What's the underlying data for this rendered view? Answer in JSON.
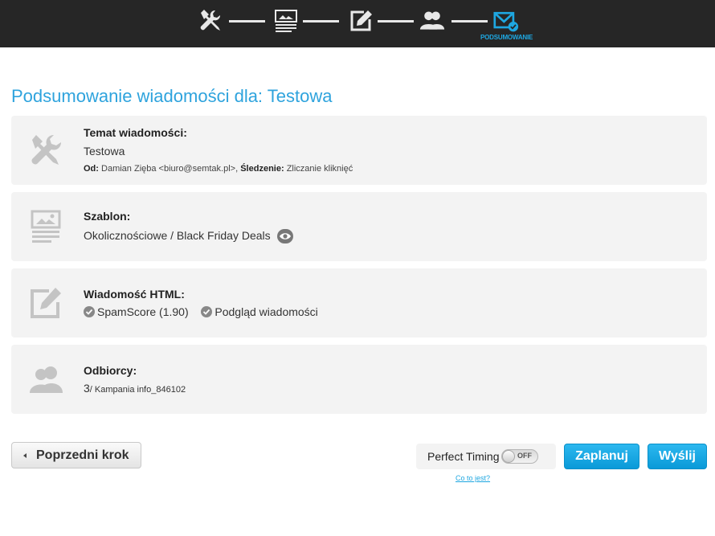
{
  "steps": {
    "active_label": "PODSUMOWANIE",
    "items": [
      {
        "icon": "tools-icon"
      },
      {
        "icon": "template-icon"
      },
      {
        "icon": "edit-icon"
      },
      {
        "icon": "users-icon"
      },
      {
        "icon": "envelope-check-icon"
      }
    ],
    "colors": {
      "active": "#1ea7e1",
      "inactive": "#e8e8e8",
      "bar": "#262626"
    }
  },
  "page": {
    "title": "Podsumowanie wiadomości dla: Testowa"
  },
  "subject_card": {
    "heading": "Temat wiadomości:",
    "value": "Testowa",
    "from_label": "Od:",
    "from_value": "Damian Zięba <biuro@semtak.pl>,",
    "tracking_label": "Śledzenie:",
    "tracking_value": "Zliczanie kliknięć"
  },
  "template_card": {
    "heading": "Szablon:",
    "value": "Okolicznościowe / Black Friday Deals"
  },
  "html_card": {
    "heading": "Wiadomość HTML:",
    "spamscore": "SpamScore (1.90)",
    "preview": "Podgląd wiadomości"
  },
  "recipients_card": {
    "heading": "Odbiorcy:",
    "count": "3",
    "campaign": "/ Kampania info_846102"
  },
  "footer": {
    "prev_label": "Poprzedni krok",
    "perfect_timing_label": "Perfect Timing",
    "toggle_state": "OFF",
    "what_is_link": "Co to jest?",
    "schedule_label": "Zaplanuj",
    "send_label": "Wyślij"
  }
}
